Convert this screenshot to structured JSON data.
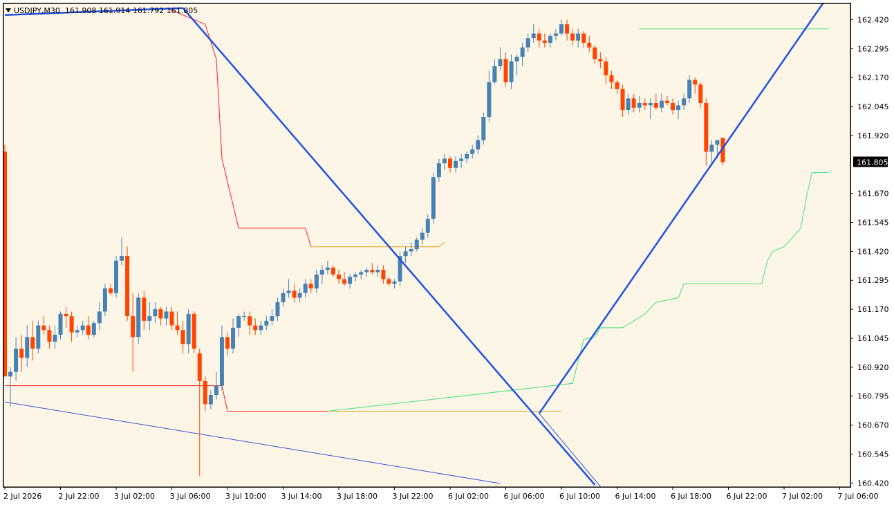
{
  "window": {
    "symbol_label": "USDJPY,M30",
    "ohlc_label": "161.908 161.914 161.792 161.805",
    "current_price_label": "161.805"
  },
  "colors": {
    "background": "#fdf5e6",
    "bull": "#4682b4",
    "bear": "#ff4500",
    "trend_line": "#1e50e6",
    "thin_trend_line": "#3355dd",
    "stop_red": "#ff2020",
    "stop_orange": "#e0a020",
    "stop_green": "#40e080",
    "price_tag_bg": "#000000",
    "price_tag_text": "#ffffff"
  },
  "chart_data": {
    "type": "candlestick",
    "symbol": "USDJPY",
    "timeframe": "M30",
    "y_ticks": [
      "162.420",
      "162.295",
      "162.170",
      "162.045",
      "161.920",
      "161.670",
      "161.545",
      "161.420",
      "161.295",
      "161.170",
      "161.045",
      "160.920",
      "160.795",
      "160.670",
      "160.545",
      "160.420"
    ],
    "ylim": [
      160.412,
      162.475
    ],
    "x_ticks": [
      "2 Jul 2026",
      "2 Jul 22:00",
      "3 Jul 02:00",
      "3 Jul 06:00",
      "3 Jul 10:00",
      "3 Jul 14:00",
      "3 Jul 18:00",
      "3 Jul 22:00",
      "6 Jul 02:00",
      "6 Jul 06:00",
      "6 Jul 10:00",
      "6 Jul 14:00",
      "6 Jul 18:00",
      "6 Jul 22:00",
      "7 Jul 02:00",
      "7 Jul 06:00"
    ],
    "last_price": 161.805,
    "candles": [
      [
        161.85,
        161.88,
        160.92,
        160.88
      ],
      [
        160.88,
        160.92,
        160.75,
        160.9
      ],
      [
        160.9,
        161.05,
        160.86,
        161.0
      ],
      [
        161.0,
        161.06,
        160.9,
        160.96
      ],
      [
        160.96,
        161.1,
        160.92,
        161.05
      ],
      [
        161.05,
        161.12,
        160.95,
        161.0
      ],
      [
        161.0,
        161.12,
        160.98,
        161.1
      ],
      [
        161.1,
        161.14,
        161.06,
        161.08
      ],
      [
        161.08,
        161.1,
        161.0,
        161.03
      ],
      [
        161.03,
        161.1,
        161.0,
        161.06
      ],
      [
        161.06,
        161.16,
        161.04,
        161.15
      ],
      [
        161.15,
        161.18,
        161.09,
        161.14
      ],
      [
        161.14,
        161.16,
        161.03,
        161.07
      ],
      [
        161.07,
        161.1,
        161.05,
        161.08
      ],
      [
        161.08,
        161.12,
        161.06,
        161.1
      ],
      [
        161.1,
        161.14,
        161.04,
        161.06
      ],
      [
        161.06,
        161.12,
        161.05,
        161.11
      ],
      [
        161.11,
        161.2,
        161.08,
        161.16
      ],
      [
        161.16,
        161.28,
        161.14,
        161.26
      ],
      [
        161.26,
        161.28,
        161.23,
        161.24
      ],
      [
        161.24,
        161.4,
        161.22,
        161.38
      ],
      [
        161.38,
        161.48,
        161.36,
        161.4
      ],
      [
        161.4,
        161.44,
        161.12,
        161.14
      ],
      [
        161.14,
        161.24,
        160.9,
        161.05
      ],
      [
        161.05,
        161.24,
        161.02,
        161.22
      ],
      [
        161.22,
        161.25,
        161.08,
        161.12
      ],
      [
        161.12,
        161.2,
        161.08,
        161.14
      ],
      [
        161.14,
        161.2,
        161.11,
        161.17
      ],
      [
        161.17,
        161.18,
        161.1,
        161.13
      ],
      [
        161.13,
        161.18,
        161.1,
        161.16
      ],
      [
        161.16,
        161.18,
        161.08,
        161.1
      ],
      [
        161.1,
        161.16,
        161.06,
        161.08
      ],
      [
        161.08,
        161.12,
        160.98,
        161.02
      ],
      [
        161.02,
        161.17,
        160.98,
        161.15
      ],
      [
        161.15,
        161.16,
        160.98,
        161.0
      ],
      [
        160.98,
        161.0,
        160.45,
        160.86
      ],
      [
        160.86,
        160.88,
        160.73,
        160.76
      ],
      [
        160.76,
        160.82,
        160.74,
        160.8
      ],
      [
        160.8,
        160.9,
        160.78,
        160.84
      ],
      [
        160.84,
        161.1,
        160.82,
        161.05
      ],
      [
        161.05,
        161.07,
        160.97,
        161.0
      ],
      [
        161.0,
        161.13,
        160.98,
        161.09
      ],
      [
        161.09,
        161.15,
        161.05,
        161.14
      ],
      [
        161.14,
        161.16,
        161.12,
        161.14
      ],
      [
        161.14,
        161.16,
        161.06,
        161.1
      ],
      [
        161.1,
        161.13,
        161.06,
        161.08
      ],
      [
        161.08,
        161.12,
        161.06,
        161.1
      ],
      [
        161.1,
        161.14,
        161.08,
        161.12
      ],
      [
        161.12,
        161.17,
        161.1,
        161.14
      ],
      [
        161.14,
        161.22,
        161.12,
        161.2
      ],
      [
        161.2,
        161.26,
        161.18,
        161.24
      ],
      [
        161.24,
        161.3,
        161.22,
        161.25
      ],
      [
        161.25,
        161.28,
        161.2,
        161.22
      ],
      [
        161.22,
        161.26,
        161.2,
        161.24
      ],
      [
        161.24,
        161.3,
        161.22,
        161.28
      ],
      [
        161.28,
        161.3,
        161.24,
        161.26
      ],
      [
        161.26,
        161.34,
        161.24,
        161.32
      ],
      [
        161.32,
        161.36,
        161.28,
        161.34
      ],
      [
        161.34,
        161.38,
        161.32,
        161.35
      ],
      [
        161.35,
        161.36,
        161.31,
        161.32
      ],
      [
        161.32,
        161.34,
        161.28,
        161.3
      ],
      [
        161.3,
        161.33,
        161.27,
        161.28
      ],
      [
        161.28,
        161.32,
        161.26,
        161.31
      ],
      [
        161.31,
        161.33,
        161.29,
        161.32
      ],
      [
        161.32,
        161.34,
        161.3,
        161.33
      ],
      [
        161.33,
        161.35,
        161.31,
        161.34
      ],
      [
        161.34,
        161.37,
        161.32,
        161.33
      ],
      [
        161.33,
        161.36,
        161.31,
        161.34
      ],
      [
        161.34,
        161.36,
        161.28,
        161.3
      ],
      [
        161.3,
        161.31,
        161.27,
        161.28
      ],
      [
        161.28,
        161.3,
        161.26,
        161.29
      ],
      [
        161.29,
        161.42,
        161.27,
        161.4
      ],
      [
        161.4,
        161.44,
        161.37,
        161.42
      ],
      [
        161.42,
        161.46,
        161.4,
        161.43
      ],
      [
        161.43,
        161.48,
        161.42,
        161.47
      ],
      [
        161.47,
        161.52,
        161.45,
        161.5
      ],
      [
        161.5,
        161.58,
        161.48,
        161.56
      ],
      [
        161.56,
        161.76,
        161.54,
        161.74
      ],
      [
        161.74,
        161.82,
        161.72,
        161.8
      ],
      [
        161.8,
        161.84,
        161.77,
        161.82
      ],
      [
        161.82,
        161.83,
        161.76,
        161.78
      ],
      [
        161.78,
        161.83,
        161.76,
        161.81
      ],
      [
        161.81,
        161.84,
        161.78,
        161.82
      ],
      [
        161.82,
        161.85,
        161.8,
        161.84
      ],
      [
        161.84,
        161.88,
        161.82,
        161.86
      ],
      [
        161.86,
        161.92,
        161.84,
        161.9
      ],
      [
        161.9,
        162.02,
        161.88,
        162.0
      ],
      [
        162.0,
        162.2,
        161.98,
        162.15
      ],
      [
        162.15,
        162.25,
        162.14,
        162.22
      ],
      [
        162.22,
        162.3,
        162.2,
        162.25
      ],
      [
        162.25,
        162.28,
        162.13,
        162.15
      ],
      [
        162.15,
        162.27,
        162.12,
        162.24
      ],
      [
        162.24,
        162.27,
        162.18,
        162.26
      ],
      [
        162.26,
        162.32,
        162.22,
        162.3
      ],
      [
        162.3,
        162.36,
        162.28,
        162.34
      ],
      [
        162.34,
        162.4,
        162.32,
        162.36
      ],
      [
        162.36,
        162.38,
        162.3,
        162.33
      ],
      [
        162.33,
        162.36,
        162.3,
        162.32
      ],
      [
        162.32,
        162.36,
        162.3,
        162.35
      ],
      [
        162.35,
        162.38,
        162.33,
        162.36
      ],
      [
        162.36,
        162.42,
        162.35,
        162.4
      ],
      [
        162.4,
        162.42,
        162.33,
        162.36
      ],
      [
        162.36,
        162.38,
        162.31,
        162.33
      ],
      [
        162.33,
        162.38,
        162.3,
        162.36
      ],
      [
        162.36,
        162.37,
        162.3,
        162.32
      ],
      [
        162.32,
        162.35,
        162.28,
        162.3
      ],
      [
        162.3,
        162.31,
        162.23,
        162.25
      ],
      [
        162.25,
        162.28,
        162.21,
        162.24
      ],
      [
        162.24,
        162.26,
        162.14,
        162.18
      ],
      [
        162.18,
        162.2,
        162.12,
        162.15
      ],
      [
        162.15,
        162.16,
        162.1,
        162.12
      ],
      [
        162.12,
        162.14,
        162.0,
        162.03
      ],
      [
        162.03,
        162.1,
        162.01,
        162.08
      ],
      [
        162.08,
        162.1,
        162.02,
        162.04
      ],
      [
        162.04,
        162.09,
        162.02,
        162.06
      ],
      [
        162.06,
        162.08,
        162.03,
        162.05
      ],
      [
        162.05,
        162.08,
        161.99,
        162.06
      ],
      [
        162.06,
        162.1,
        162.03,
        162.04
      ],
      [
        162.04,
        162.1,
        162.02,
        162.07
      ],
      [
        162.07,
        162.09,
        162.05,
        162.06
      ],
      [
        162.06,
        162.08,
        162.01,
        162.03
      ],
      [
        162.03,
        162.07,
        161.99,
        162.05
      ],
      [
        162.05,
        162.1,
        162.03,
        162.08
      ],
      [
        162.08,
        162.18,
        162.06,
        162.16
      ],
      [
        162.16,
        162.17,
        162.1,
        162.14
      ],
      [
        162.14,
        162.15,
        162.04,
        162.06
      ],
      [
        162.06,
        162.08,
        161.79,
        161.85
      ],
      [
        161.85,
        161.9,
        161.79,
        161.88
      ],
      [
        161.88,
        161.9,
        161.82,
        161.9
      ],
      [
        161.91,
        161.91,
        161.79,
        161.805
      ]
    ],
    "overlays": {
      "trendline_upper": {
        "from": {
          "bar": 0,
          "price": 162.44
        },
        "to": {
          "bar": 32,
          "price": 162.47
        }
      },
      "trendline_down": {
        "from": {
          "bar": 32,
          "price": 162.47
        },
        "to": {
          "bar": 106,
          "price": 160.412
        }
      },
      "trendline_up": {
        "from": {
          "bar": 96,
          "price": 160.72
        },
        "to": {
          "bar": 132,
          "price": 161.97
        }
      },
      "trendline_lower": {
        "from": {
          "bar": 0,
          "price": 160.77
        },
        "to": {
          "bar": 89,
          "price": 160.418
        }
      },
      "stop_upper": [
        {
          "bar": 29,
          "price": 162.47
        },
        {
          "bar": 31,
          "price": 162.45
        },
        {
          "bar": 33,
          "price": 162.43
        },
        {
          "bar": 36,
          "price": 162.4
        },
        {
          "bar": 38,
          "price": 162.25
        },
        {
          "bar": 39,
          "price": 161.82
        },
        {
          "bar": 42,
          "price": 161.52
        },
        {
          "bar": 54,
          "price": 161.52
        },
        {
          "bar": 55,
          "price": 161.44
        },
        {
          "bar": 78,
          "price": 161.44
        },
        {
          "bar": 79,
          "price": 161.46
        }
      ],
      "stop_lower": [
        {
          "bar": 0,
          "price": 160.84
        },
        {
          "bar": 39,
          "price": 160.84
        },
        {
          "bar": 40,
          "price": 160.73
        },
        {
          "bar": 100,
          "price": 160.73
        },
        {
          "bar": 102,
          "price": 160.85
        },
        {
          "bar": 104,
          "price": 161.04
        },
        {
          "bar": 106,
          "price": 161.05
        },
        {
          "bar": 107,
          "price": 161.09
        },
        {
          "bar": 111,
          "price": 161.09
        },
        {
          "bar": 115,
          "price": 161.15
        },
        {
          "bar": 117,
          "price": 161.2
        },
        {
          "bar": 121,
          "price": 161.22
        },
        {
          "bar": 122,
          "price": 161.28
        },
        {
          "bar": 136,
          "price": 161.28
        },
        {
          "bar": 137,
          "price": 161.38
        },
        {
          "bar": 138,
          "price": 161.42
        },
        {
          "bar": 140,
          "price": 161.44
        },
        {
          "bar": 143,
          "price": 161.52
        },
        {
          "bar": 144,
          "price": 161.65
        },
        {
          "bar": 145,
          "price": 161.76
        },
        {
          "bar": 148,
          "price": 161.76
        }
      ],
      "resistance_line": {
        "from": {
          "bar": 114,
          "price": 162.38
        },
        "to": {
          "bar": 148,
          "price": 162.38
        }
      }
    }
  }
}
